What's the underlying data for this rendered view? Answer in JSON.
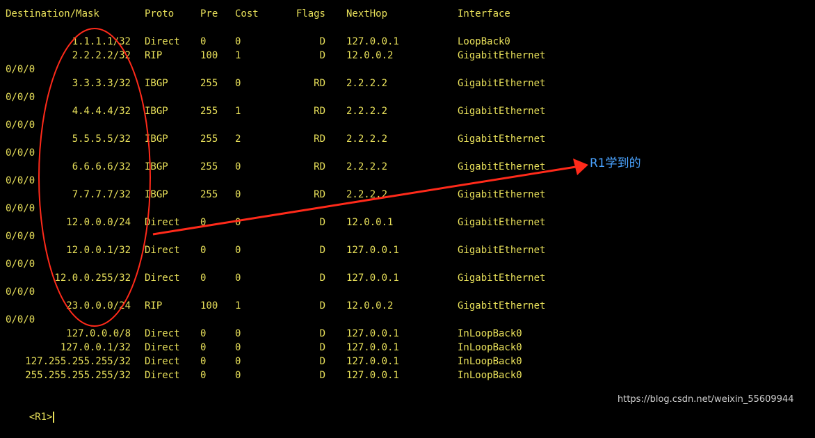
{
  "terminal": {
    "headers": {
      "dest": "Destination/Mask",
      "proto": "Proto",
      "pre": "Pre",
      "cost": "Cost",
      "flags": "Flags",
      "nexthop": "NextHop",
      "iface": "Interface"
    },
    "routes": [
      {
        "dest": "1.1.1.1/32",
        "proto": "Direct",
        "pre": "0",
        "cost": "0",
        "flags": "D",
        "nexthop": "127.0.0.1",
        "iface": "LoopBack0",
        "cont": ""
      },
      {
        "dest": "2.2.2.2/32",
        "proto": "RIP",
        "pre": "100",
        "cost": "1",
        "flags": "D",
        "nexthop": "12.0.0.2",
        "iface": "GigabitEthernet",
        "cont": "0/0/0"
      },
      {
        "dest": "3.3.3.3/32",
        "proto": "IBGP",
        "pre": "255",
        "cost": "0",
        "flags": "RD",
        "nexthop": "2.2.2.2",
        "iface": "GigabitEthernet",
        "cont": "0/0/0"
      },
      {
        "dest": "4.4.4.4/32",
        "proto": "IBGP",
        "pre": "255",
        "cost": "1",
        "flags": "RD",
        "nexthop": "2.2.2.2",
        "iface": "GigabitEthernet",
        "cont": "0/0/0"
      },
      {
        "dest": "5.5.5.5/32",
        "proto": "IBGP",
        "pre": "255",
        "cost": "2",
        "flags": "RD",
        "nexthop": "2.2.2.2",
        "iface": "GigabitEthernet",
        "cont": "0/0/0"
      },
      {
        "dest": "6.6.6.6/32",
        "proto": "IBGP",
        "pre": "255",
        "cost": "0",
        "flags": "RD",
        "nexthop": "2.2.2.2",
        "iface": "GigabitEthernet",
        "cont": "0/0/0"
      },
      {
        "dest": "7.7.7.7/32",
        "proto": "IBGP",
        "pre": "255",
        "cost": "0",
        "flags": "RD",
        "nexthop": "2.2.2.2",
        "iface": "GigabitEthernet",
        "cont": "0/0/0"
      },
      {
        "dest": "12.0.0.0/24",
        "proto": "Direct",
        "pre": "0",
        "cost": "0",
        "flags": "D",
        "nexthop": "12.0.0.1",
        "iface": "GigabitEthernet",
        "cont": "0/0/0"
      },
      {
        "dest": "12.0.0.1/32",
        "proto": "Direct",
        "pre": "0",
        "cost": "0",
        "flags": "D",
        "nexthop": "127.0.0.1",
        "iface": "GigabitEthernet",
        "cont": "0/0/0"
      },
      {
        "dest": "12.0.0.255/32",
        "proto": "Direct",
        "pre": "0",
        "cost": "0",
        "flags": "D",
        "nexthop": "127.0.0.1",
        "iface": "GigabitEthernet",
        "cont": "0/0/0"
      },
      {
        "dest": "23.0.0.0/24",
        "proto": "RIP",
        "pre": "100",
        "cost": "1",
        "flags": "D",
        "nexthop": "12.0.0.2",
        "iface": "GigabitEthernet",
        "cont": "0/0/0"
      },
      {
        "dest": "127.0.0.0/8",
        "proto": "Direct",
        "pre": "0",
        "cost": "0",
        "flags": "D",
        "nexthop": "127.0.0.1",
        "iface": "InLoopBack0",
        "cont": ""
      },
      {
        "dest": "127.0.0.1/32",
        "proto": "Direct",
        "pre": "0",
        "cost": "0",
        "flags": "D",
        "nexthop": "127.0.0.1",
        "iface": "InLoopBack0",
        "cont": ""
      },
      {
        "dest": "127.255.255.255/32",
        "proto": "Direct",
        "pre": "0",
        "cost": "0",
        "flags": "D",
        "nexthop": "127.0.0.1",
        "iface": "InLoopBack0",
        "cont": ""
      },
      {
        "dest": "255.255.255.255/32",
        "proto": "Direct",
        "pre": "0",
        "cost": "0",
        "flags": "D",
        "nexthop": "127.0.0.1",
        "iface": "InLoopBack0",
        "cont": ""
      }
    ],
    "prompt": "<R1>"
  },
  "annotation": {
    "note": "R1学到的",
    "note_color": "#4aa3ff",
    "mark_color": "#ff2a1a"
  },
  "watermark": "https://blog.csdn.net/weixin_55609944",
  "colors": {
    "background": "#000000",
    "terminal_text": "#e8e05a"
  }
}
